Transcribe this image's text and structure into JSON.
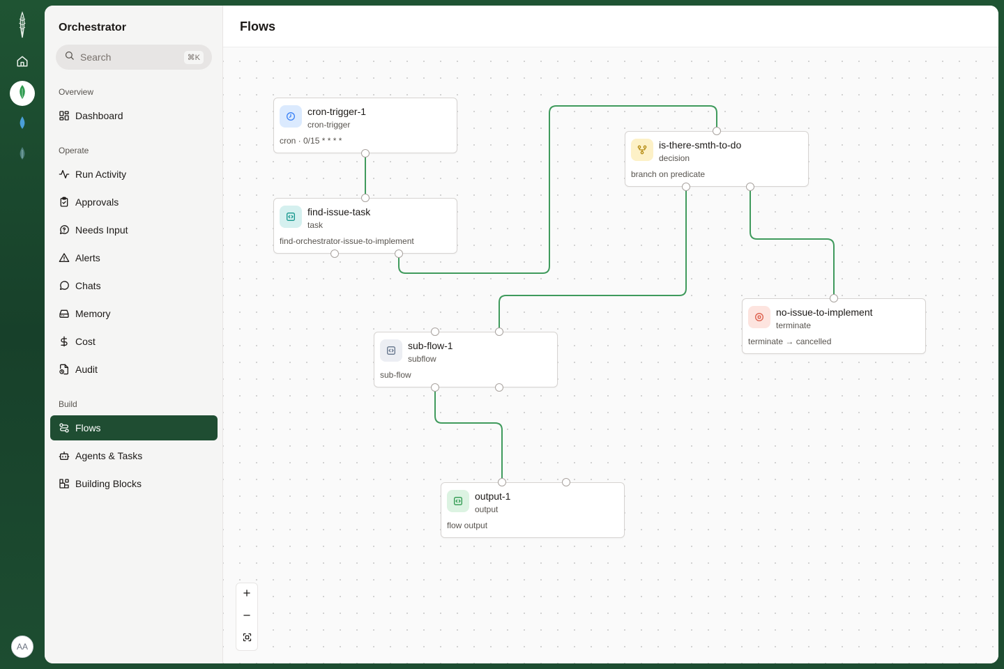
{
  "rail": {
    "items": [
      {
        "name": "home",
        "icon": "home-icon"
      },
      {
        "name": "orchestrator",
        "icon": "green-leaf-icon",
        "active": true
      },
      {
        "name": "droplet",
        "icon": "blue-drop-icon"
      },
      {
        "name": "leaf",
        "icon": "teal-leaf-icon"
      }
    ],
    "avatar": "AA"
  },
  "sidebar": {
    "title": "Orchestrator",
    "search": {
      "placeholder": "Search",
      "shortcut": "⌘K"
    },
    "sections": {
      "overview": "Overview",
      "operate": "Operate",
      "build": "Build"
    },
    "items": {
      "dashboard": "Dashboard",
      "run_activity": "Run Activity",
      "approvals": "Approvals",
      "needs_input": "Needs Input",
      "alerts": "Alerts",
      "chats": "Chats",
      "memory": "Memory",
      "cost": "Cost",
      "audit": "Audit",
      "flows": "Flows",
      "agents_tasks": "Agents & Tasks",
      "building_blocks": "Building Blocks"
    },
    "active": "Flows"
  },
  "main": {
    "title": "Flows"
  },
  "flow": {
    "nodes": {
      "cron": {
        "title": "cron-trigger-1",
        "type": "cron-trigger",
        "detail": "cron · 0/15 * * * *",
        "icon": "clock-icon"
      },
      "find": {
        "title": "find-issue-task",
        "type": "task",
        "detail": "find-orchestrator-issue-to-implement",
        "icon": "code-icon"
      },
      "decision": {
        "title": "is-there-smth-to-do",
        "type": "decision",
        "detail": "branch on predicate",
        "icon": "branch-icon"
      },
      "terminate": {
        "title": "no-issue-to-implement",
        "type": "terminate",
        "detail": "terminate → cancelled",
        "icon": "stop-icon"
      },
      "subflow": {
        "title": "sub-flow-1",
        "type": "subflow",
        "detail": "sub-flow",
        "icon": "code-icon"
      },
      "output": {
        "title": "output-1",
        "type": "output",
        "detail": "flow output",
        "icon": "code-icon"
      }
    },
    "edges": [
      {
        "from": "cron-trigger-1",
        "to": "find-issue-task"
      },
      {
        "from": "find-issue-task",
        "to": "is-there-smth-to-do"
      },
      {
        "from": "is-there-smth-to-do",
        "to": "sub-flow-1"
      },
      {
        "from": "is-there-smth-to-do",
        "to": "no-issue-to-implement"
      },
      {
        "from": "sub-flow-1",
        "to": "output-1"
      }
    ]
  },
  "zoom_controls": [
    "zoom-in",
    "zoom-out",
    "fit-view"
  ],
  "colors": {
    "accent": "#1f4d32",
    "edge": "#3f9a5c",
    "background": "#1c4a2e"
  }
}
